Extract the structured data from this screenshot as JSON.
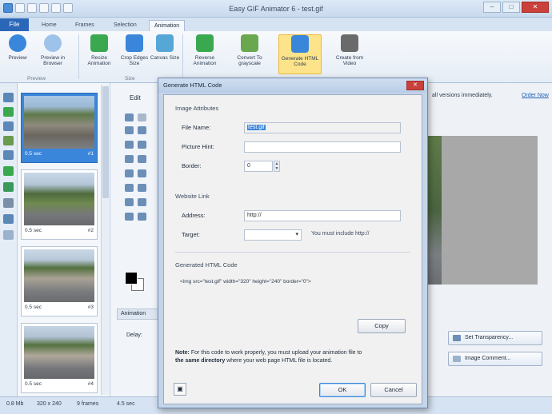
{
  "window": {
    "title": "Easy GIF Animator 6 - test.gif",
    "controls": [
      "–",
      "□",
      "✕"
    ]
  },
  "ribbon": {
    "file_tab": "File",
    "tabs": [
      "Home",
      "Frames",
      "Selection",
      "Animation"
    ],
    "active_tab": "Animation",
    "buttons": [
      {
        "label": "Preview",
        "icon": "preview-icon",
        "color": "#3a86da"
      },
      {
        "label": "Preview in Browser",
        "icon": "browser-preview-icon",
        "color": "#4a90d9"
      },
      {
        "label": "Resize Animation",
        "icon": "resize-animation-icon",
        "color": "#3aa84e"
      },
      {
        "label": "Crop Edges Size",
        "icon": "crop-icon",
        "color": "#3a86da"
      },
      {
        "label": "Canvas Size",
        "icon": "canvas-size-icon",
        "color": "#56a6d8"
      },
      {
        "label": "Reverse Animation",
        "icon": "reverse-animation-icon",
        "color": "#3aa84e"
      },
      {
        "label": "Convert To grayscale",
        "icon": "grayscale-icon",
        "color": "#6aa84f"
      },
      {
        "label": "Generate HTML Code",
        "icon": "html-code-icon",
        "color": "#3a86da"
      },
      {
        "label": "Create from Video",
        "icon": "video-icon",
        "color": "#6a6a6a"
      }
    ],
    "groups": [
      "Preview",
      "Size"
    ]
  },
  "frames": [
    {
      "delay": "0.5 sec",
      "number": "#1"
    },
    {
      "delay": "0.5 sec",
      "number": "#2"
    },
    {
      "delay": "0.5 sec",
      "number": "#3"
    },
    {
      "delay": "0.5 sec",
      "number": "#4"
    }
  ],
  "edit_panel": {
    "label": "Edit",
    "animation_tab": "Animation",
    "delay_label": "Delay:"
  },
  "right_panel": {
    "notice": "all versions immediately.",
    "notice_link": "Order Now",
    "set_transparency": "Set Transparency...",
    "image_comment": "Image Comment..."
  },
  "status_bar": {
    "size": "0.8 Mb",
    "dimensions": "320 x 240",
    "frames": "9 frames",
    "duration": "4.5 sec"
  },
  "dialog": {
    "title": "Generate HTML Code",
    "close": "✕",
    "image_attributes": "Image Attributes",
    "file_name_label": "File Name:",
    "file_name_value": "test.gif",
    "picture_hint_label": "Picture Hint:",
    "picture_hint_value": "",
    "border_label": "Border:",
    "border_value": "0",
    "website_link": "Website Link",
    "address_label": "Address:",
    "address_value": "http://",
    "target_label": "Target:",
    "target_value": "",
    "target_hint": "You must include http://",
    "generated_code_title": "Generated HTML Code",
    "generated_code": "<img src=\"test.gif\" width=\"320\" height=\"240\" border=\"0\">",
    "copy_button": "Copy",
    "note_prefix": "Note:",
    "note_text": " For this code to work properly, you must upload your animation file to",
    "note_bold": "the same directory",
    "note_suffix": " where your web page HTML file is located.",
    "ok_button": "OK",
    "cancel_button": "Cancel"
  }
}
